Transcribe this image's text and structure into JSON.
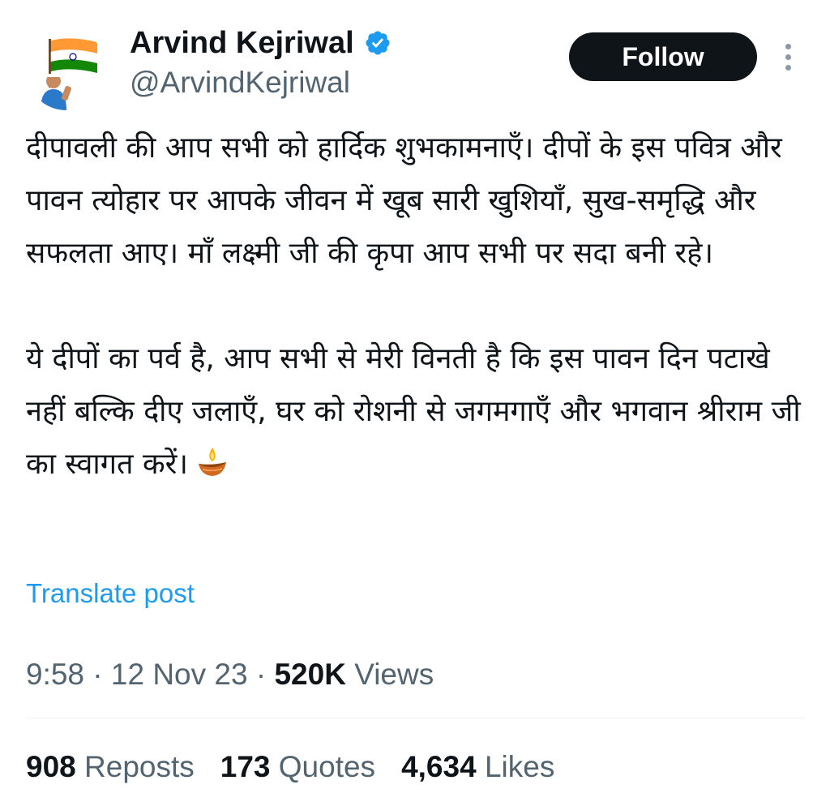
{
  "author": {
    "display_name": "Arvind Kejriwal",
    "handle": "@ArvindKejriwal",
    "verified": true,
    "avatar_icon": "avatar-with-indian-flag",
    "verified_color": "#1d9bf0"
  },
  "actions": {
    "follow_label": "Follow",
    "more_icon": "vertical-ellipsis-icon"
  },
  "tweet": {
    "paragraph_1": "दीपावली की आप सभी को हार्दिक शुभकामनाएँ। दीपों के इस पवित्र और पावन त्योहार पर आपके जीवन में खूब सारी खुशियाँ, सुख-समृद्धि और सफलता आए। माँ लक्ष्मी जी की कृपा आप सभी पर सदा बनी रहे।",
    "paragraph_2": "ये दीपों का पर्व है, आप सभी से मेरी विनती है कि इस पावन दिन पटाखे नहीं बल्कि दीए जलाएँ, घर को रोशनी से जगमगाएँ और भगवान श्रीराम जी का स्वागत करें।",
    "emoji_icon": "diya-lamp-icon",
    "translate_label": "Translate post"
  },
  "meta": {
    "time": "9:58",
    "separator": "·",
    "date": "12 Nov 23",
    "views_count": "520K",
    "views_label": "Views"
  },
  "stats": {
    "reposts_count": "908",
    "reposts_label": "Reposts",
    "quotes_count": "173",
    "quotes_label": "Quotes",
    "likes_count": "4,634",
    "likes_label": "Likes"
  },
  "colors": {
    "text_primary": "#0f1419",
    "text_secondary": "#536471",
    "link": "#1d9bf0",
    "button_bg": "#0f1419"
  }
}
